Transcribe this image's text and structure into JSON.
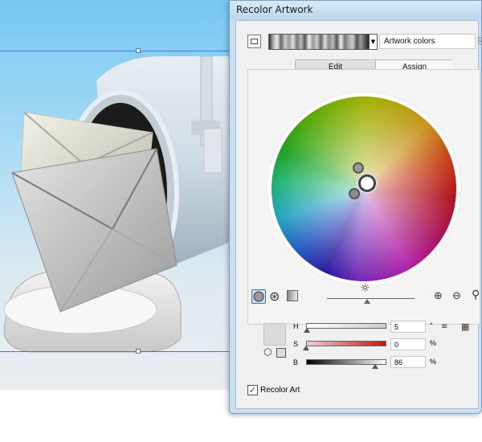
{
  "window": {
    "title": "Recolor Artwork"
  },
  "colors": {
    "accent": "#4f72d8",
    "dialog_frame": "#c7dff1",
    "sky_top": "#76c8f3"
  },
  "top_bar": {
    "artwork_field": "Artwork colors",
    "gradient_dropdown_icon": "chevron-down-icon",
    "new_swatch_icon": "save-group-icon"
  },
  "tabs": [
    {
      "label": "Edit"
    },
    {
      "label": "Assign"
    }
  ],
  "toolbar": {
    "harmony_icon": "link-harmony-icon",
    "segmented_icon": "segmented-wheel-icon",
    "bars_icon": "color-bars-icon",
    "brightness_icon": "brightness-sun-icon",
    "add_color_icon": "add-color-icon",
    "remove_color_icon": "remove-color-icon",
    "unlink_icon": "link-icon"
  },
  "brightness": 0.46,
  "hsb": {
    "h": {
      "label": "H",
      "value": "5",
      "unit": "°"
    },
    "s": {
      "label": "S",
      "value": "0",
      "unit": "%"
    },
    "b": {
      "label": "B",
      "value": "86",
      "unit": "%"
    }
  },
  "hsb_levels": {
    "h": 0.014,
    "s": 0.0,
    "b": 0.86
  },
  "recolor_art": {
    "label": "Recolor Art",
    "checked": true
  }
}
